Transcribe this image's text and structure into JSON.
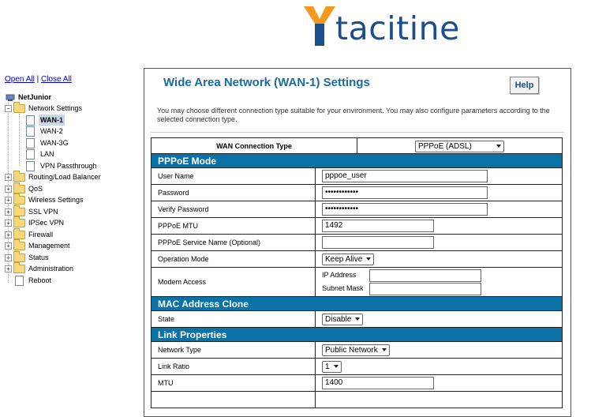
{
  "brand": {
    "name": "tacitine",
    "logo_colors": {
      "orange": "#f39a1e",
      "blue": "#1b4f8c"
    }
  },
  "tree": {
    "open_all": "Open All",
    "separator": "|",
    "close_all": "Close All",
    "root": "NetJunior",
    "items": [
      {
        "label": "Network Settings"
      },
      {
        "label": "WAN-1"
      },
      {
        "label": "WAN-2"
      },
      {
        "label": "WAN-3G"
      },
      {
        "label": "LAN"
      },
      {
        "label": "VPN Passthrough"
      },
      {
        "label": "Routing/Load Balancer"
      },
      {
        "label": "QoS"
      },
      {
        "label": "Wireless Settings"
      },
      {
        "label": "SSL VPN"
      },
      {
        "label": "IPSec VPN"
      },
      {
        "label": "Firewall"
      },
      {
        "label": "Management"
      },
      {
        "label": "Status"
      },
      {
        "label": "Administration"
      },
      {
        "label": "Reboot"
      }
    ]
  },
  "main": {
    "title": "Wide Area Network (WAN-1) Settings",
    "help": "Help",
    "intro": "You may choose different connection type suitable for your environment. You may also configure parameters according to the selected connection type.",
    "wan_type_label": "WAN Connection Type",
    "wan_type_value": "PPPoE (ADSL)",
    "sections": {
      "pppoe": "PPPoE Mode",
      "mac": "MAC Address Clone",
      "link": "Link Properties"
    },
    "fields": {
      "user_name": {
        "label": "User Name",
        "value": "pppoe_user"
      },
      "password": {
        "label": "Password",
        "value": "••••••••••••"
      },
      "verify_password": {
        "label": "Verify Password",
        "value": "••••••••••••"
      },
      "pppoe_mtu": {
        "label": "PPPoE MTU",
        "value": "1492"
      },
      "service_name": {
        "label": "PPPoE Service Name (Optional)",
        "value": ""
      },
      "operation_mode": {
        "label": "Operation Mode",
        "value": "Keep Alive"
      },
      "modem_access": {
        "label": "Modem Access",
        "ip_label": "IP Address",
        "mask_label": "Subnet Mask",
        "ip_value": "",
        "mask_value": ""
      },
      "state": {
        "label": "State",
        "value": "Disable"
      },
      "network_type": {
        "label": "Network Type",
        "value": "Public Network"
      },
      "link_ratio": {
        "label": "Link Ratio",
        "value": "1"
      },
      "mtu": {
        "label": "MTU",
        "value": "1400"
      }
    }
  }
}
